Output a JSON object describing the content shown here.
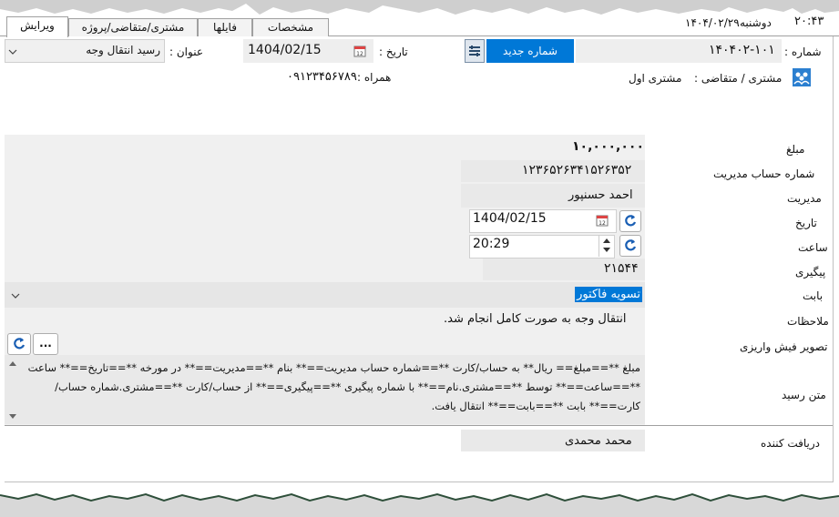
{
  "topbar": {
    "weekday": "دوشنبه",
    "date": "۱۴۰۴/۰۲/۲۹",
    "time": "۲۰:۴۳"
  },
  "tabs": [
    {
      "label": "ویرایش"
    },
    {
      "label": "مشتری/متقاضی/پروژه"
    },
    {
      "label": "فایلها"
    },
    {
      "label": "مشخصات"
    }
  ],
  "header": {
    "number_label": "شماره :",
    "number_value": "۱۴۰۴۰۲-۱۰۱",
    "new_number_button": "شماره جدید",
    "date_label": "تاریخ :",
    "date_value": "1404/02/15",
    "title_label": "عنوان :",
    "title_value": "رسید انتقال وجه",
    "customer_label": "مشتری / متقاضی :",
    "customer_value": "مشتری اول",
    "mobile_label": "همراه :",
    "mobile_value": "۰۹۱۲۳۴۵۶۷۸۹"
  },
  "form": {
    "amount_label": "مبلغ",
    "amount_value": "۱۰,۰۰۰,۰۰۰",
    "account_label": "شماره حساب مدیریت",
    "account_value": "۱۲۳۶۵۲۶۳۴۱۵۲۶۳۵۲",
    "manager_label": "مدیریت",
    "manager_value": "احمد حسنپور",
    "date_label": "تاریخ",
    "date_value": "1404/02/15",
    "time_label": "ساعت",
    "time_value": "20:29",
    "tracking_label": "پیگیری",
    "tracking_value": "۲۱۵۴۴",
    "reason_label": "بابت",
    "reason_value": "تسویه فاکتور",
    "notes_label": "ملاحظات",
    "notes_value": "انتقال وجه به صورت کامل انجام شد.",
    "receipt_image_label": "تصویر فیش واریزی",
    "browse_button": "...",
    "receipt_text_label": "متن رسید",
    "receipt_text": "مبلغ **==مبلغ== ریال** به حساب/کارت **==شماره حساب مدیریت==** بنام **==مدیریت==** در مورخه **==تاریخ==** ساعت **==ساعت==** توسط **==مشتری.نام==** با شماره پیگیری **==پیگیری==** از حساب/کارت **==مشتری.شماره حساب/کارت==** بابت **==بابت==** انتقال یافت.",
    "receiver_label": "دریافت کننده",
    "receiver_value": "محمد محمدی"
  },
  "colors": {
    "accent": "#0078d7",
    "selection": "#0078d7",
    "field_bg": "#eeeeee"
  },
  "icons": [
    "calendar-icon",
    "settings-list-icon",
    "customer-icon",
    "refresh-icon",
    "spinner-up-icon",
    "spinner-down-icon",
    "dropdown-arrow-icon",
    "scroll-up-icon",
    "scroll-down-icon"
  ]
}
